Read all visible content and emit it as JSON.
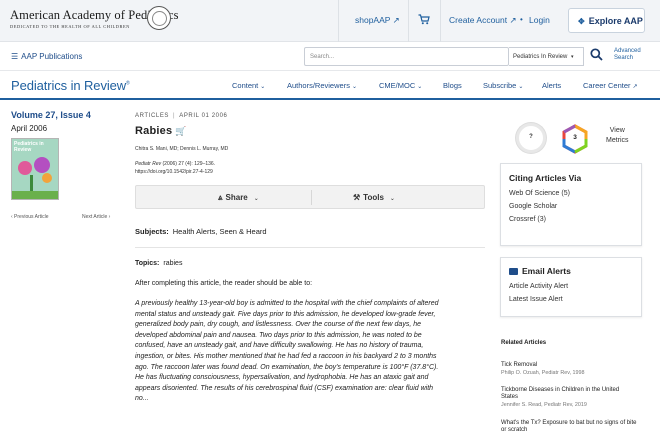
{
  "header": {
    "org_name": "American Academy of Pediatrics",
    "org_tagline": "DEDICATED TO THE HEALTH OF ALL CHILDREN",
    "shop_label": "shopAAP ↗",
    "create_account_label": "Create Account ↗",
    "login_label": "Login",
    "explore_label": "Explore AAP"
  },
  "subheader": {
    "publications_label": "AAP Publications",
    "search_placeholder": "Search...",
    "search_scope": "Pediatrics In Review",
    "advanced_search_line1": "Advanced",
    "advanced_search_line2": "Search"
  },
  "journal": {
    "title": "Pediatrics in Review",
    "nav": [
      {
        "label": "Content"
      },
      {
        "label": "Authors/Reviewers"
      },
      {
        "label": "CME/MOC"
      },
      {
        "label": "Blogs"
      },
      {
        "label": "Subscribe"
      },
      {
        "label": "Alerts"
      },
      {
        "label": "Career Center"
      }
    ]
  },
  "issue": {
    "volume": "Volume 27, Issue 4",
    "date": "April 2006",
    "cover_title": "Pediatrics in Review",
    "prev_label": "‹ Previous Article",
    "next_label": "Next Article ›"
  },
  "article": {
    "category": "ARTICLES",
    "date": "APRIL 01 2006",
    "title": "Rabies",
    "authors": "Chitra S. Mani, MD; Dennis L. Murray, MD",
    "citation_journal": "Pediatr Rev",
    "citation_detail": "(2006) 27 (4): 129–136.",
    "doi": "https://doi.org/10.1542/pir.27-4-129",
    "share_label": "Share",
    "tools_label": "Tools",
    "subjects_label": "Subjects:",
    "subjects_value": "Health Alerts, Seen & Heard",
    "topics_label": "Topics:",
    "topics_value": "rabies",
    "objectives_intro": "After completing this article, the reader should be able to:",
    "body_lines": [
      "A previously healthy 13-year-old boy is admitted to the hospital with the chief complaints of altered",
      "mental status and unsteady gait. Five days prior to this admission, he developed low-grade fever,",
      "generalized body pain, dry cough, and listlessness. Over the course of the next few days, he",
      "developed abdominal pain and nausea. Two days prior to this admission, he was noted to be",
      "confused, have an unsteady gait, and have difficulty swallowing. He has no history of trauma,",
      "ingestion, or bites. His mother mentioned that he had fed a raccoon in his backyard 2 to 3 months",
      "ago. The raccoon later was found dead. On examination, the boy's temperature is 100°F (37.8°C).",
      "He has fluctuating consciousness, hypersalivation, and hydrophobia. He has an ataxic gait and",
      "appears disoriented. The results of his cerebrospinal fluid (CSF) examination are: clear fluid with",
      "no..."
    ]
  },
  "metrics": {
    "dimensions_value": "?",
    "altmetric_value": "3",
    "view_label_line1": "View",
    "view_label_line2": "Metrics"
  },
  "citing": {
    "heading": "Citing Articles Via",
    "items": [
      {
        "label": "Web Of Science (5)"
      },
      {
        "label": "Google Scholar"
      },
      {
        "label": "Crossref (3)"
      }
    ]
  },
  "alerts": {
    "heading": "Email Alerts",
    "items": [
      {
        "label": "Article Activity Alert"
      },
      {
        "label": "Latest Issue Alert"
      }
    ]
  },
  "related": {
    "heading": "Related Articles",
    "items": [
      {
        "title_lines": [
          "Tick Removal"
        ],
        "meta": "Philip O. Ozuah, Pediatr Rev, 1998"
      },
      {
        "title_lines": [
          "Tickborne Diseases in Children in the United",
          "States"
        ],
        "meta": "Jennifer S. Read, Pediatr Rev, 2019"
      },
      {
        "title_lines": [
          "What's the Tx? Exposure to bat but no signs of bite",
          "or scratch"
        ],
        "meta": ""
      }
    ]
  },
  "colors": {
    "link_blue": "#1f5f9e",
    "navy": "#1f4d8a"
  }
}
